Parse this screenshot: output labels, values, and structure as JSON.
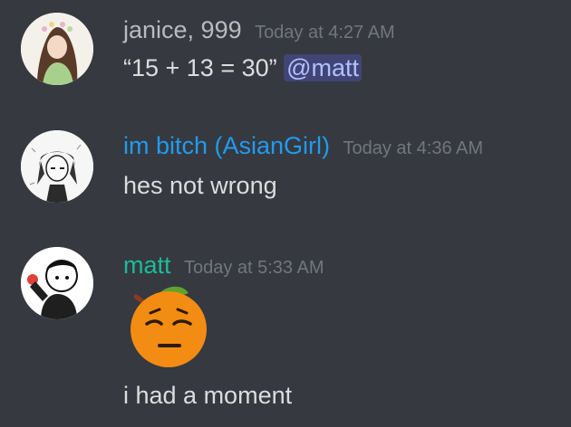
{
  "messages": [
    {
      "author": "janice, 999",
      "author_color": "#b9bbbe",
      "timestamp": "Today at 4:27 AM",
      "text": "“15 + 13 = 30”",
      "mention": "@matt",
      "avatar_icon": "user-avatar-icon"
    },
    {
      "author": "im bitch (AsianGirl)",
      "author_color": "#1f9cf0",
      "timestamp": "Today at 4:36 AM",
      "text": "hes not wrong",
      "avatar_icon": "user-avatar-icon"
    },
    {
      "author": "matt",
      "author_color": "#1abc9c",
      "timestamp": "Today at 5:33 AM",
      "emoji_icon": "orange-pensive-emoji-icon",
      "text": "i had a moment",
      "avatar_icon": "user-avatar-icon"
    }
  ],
  "theme": {
    "background": "#36393f",
    "text": "#dcddde",
    "timestamp": "#72767d"
  }
}
